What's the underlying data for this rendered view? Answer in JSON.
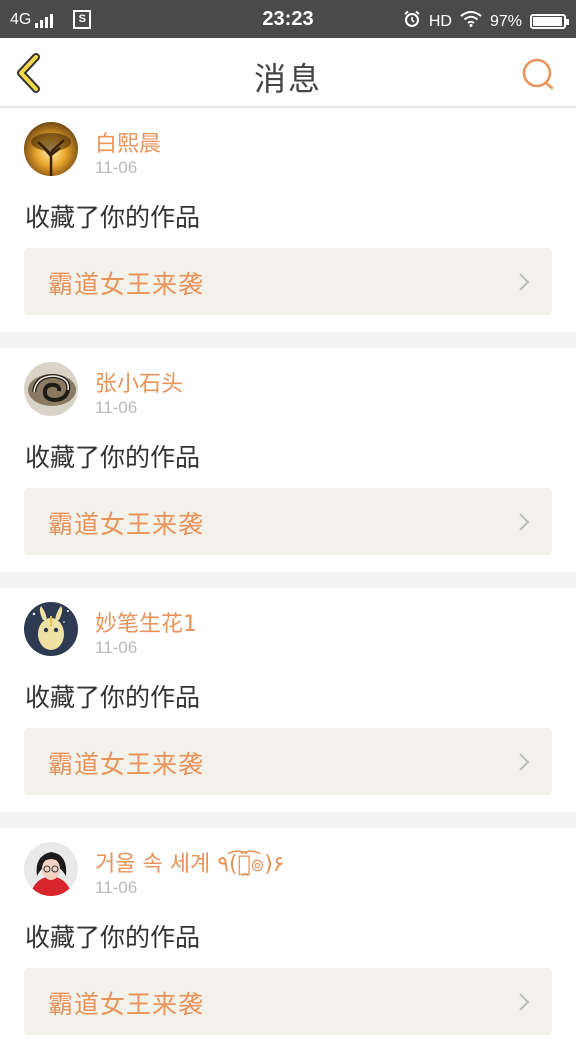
{
  "status_bar": {
    "network": "4G",
    "sim_icon_label": "S",
    "time": "23:23",
    "hd": "HD",
    "battery_percent": "97%",
    "battery_level": 0.97
  },
  "nav": {
    "title": "消息",
    "back_icon": "chevron-left-icon",
    "search_icon": "search-icon",
    "accent_color": "#e8935a"
  },
  "messages": [
    {
      "username": "白熙晨",
      "date": "11-06",
      "action": "收藏了你的作品",
      "work_title": "霸道女王来袭",
      "avatar": "tree-sunset-avatar"
    },
    {
      "username": "张小石头",
      "date": "11-06",
      "action": "收藏了你的作品",
      "work_title": "霸道女王来袭",
      "avatar": "swirl-avatar"
    },
    {
      "username": "妙笔生花1",
      "date": "11-06",
      "action": "收藏了你的作品",
      "work_title": "霸道女王来袭",
      "avatar": "cartoon-avatar"
    },
    {
      "username": "거울 속 세계 ٩(͡๏̯͡๏)۶",
      "date": "11-06",
      "action": "收藏了你的作品",
      "work_title": "霸道女王来袭",
      "avatar": "girl-avatar"
    }
  ]
}
